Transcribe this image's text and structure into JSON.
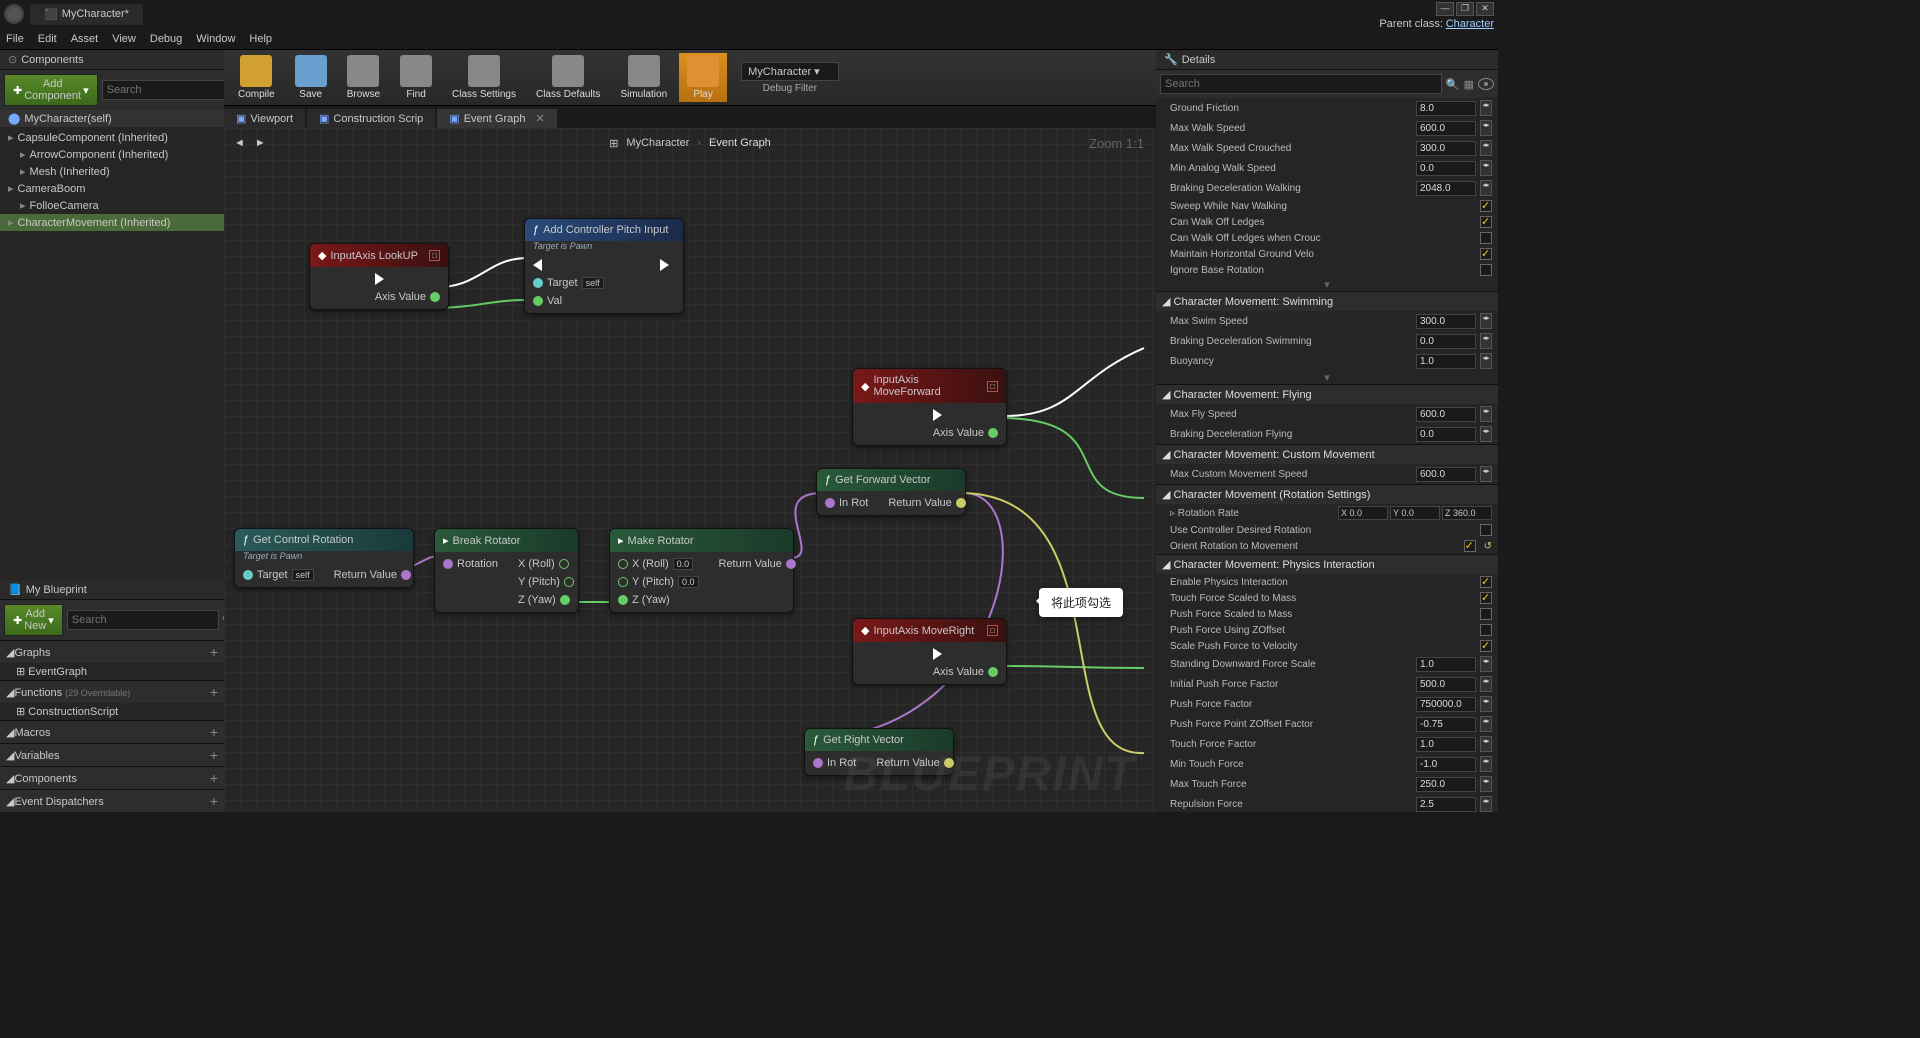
{
  "window": {
    "title": "MyCharacter*"
  },
  "parent_class": {
    "label": "Parent class:",
    "value": "Character"
  },
  "menu": [
    "File",
    "Edit",
    "Asset",
    "View",
    "Debug",
    "Window",
    "Help"
  ],
  "components_panel": {
    "title": "Components",
    "add_btn": "Add Component",
    "search": "Search",
    "root_actor": "MyCharacter(self)",
    "tree": [
      {
        "label": "CapsuleComponent (Inherited)",
        "indent": 0
      },
      {
        "label": "ArrowComponent (Inherited)",
        "indent": 1
      },
      {
        "label": "Mesh (Inherited)",
        "indent": 1
      },
      {
        "label": "CameraBoom",
        "indent": 0
      },
      {
        "label": "FolloeCamera",
        "indent": 1
      },
      {
        "label": "CharacterMovement (Inherited)",
        "indent": 0,
        "selected": true
      }
    ]
  },
  "my_blueprint": {
    "title": "My Blueprint",
    "add_btn": "Add New",
    "search": "Search",
    "sections": [
      {
        "name": "Graphs",
        "items": [
          "EventGraph"
        ]
      },
      {
        "name": "Functions",
        "suffix": "(29 Overridable)",
        "items": [
          "ConstructionScript"
        ]
      },
      {
        "name": "Macros",
        "items": []
      },
      {
        "name": "Variables",
        "items": []
      },
      {
        "name": "Components",
        "items": []
      },
      {
        "name": "Event Dispatchers",
        "items": []
      }
    ]
  },
  "toolbar": {
    "buttons": [
      {
        "label": "Compile",
        "color": "#d0a030"
      },
      {
        "label": "Save",
        "color": "#6aa0d0"
      },
      {
        "label": "Browse",
        "color": "#888"
      },
      {
        "label": "Find",
        "color": "#888"
      },
      {
        "label": "Class Settings",
        "color": "#888"
      },
      {
        "label": "Class Defaults",
        "color": "#888"
      },
      {
        "label": "Simulation",
        "color": "#888"
      },
      {
        "label": "Play",
        "color": "#e09030",
        "active": true
      }
    ],
    "debug_target": "MyCharacter",
    "debug_label": "Debug Filter"
  },
  "graph_tabs": [
    {
      "label": "Viewport"
    },
    {
      "label": "Construction Scrip"
    },
    {
      "label": "Event Graph",
      "active": true
    }
  ],
  "breadcrumb": {
    "icon": "⊞",
    "parent": "MyCharacter",
    "child": "Event Graph"
  },
  "zoom": "Zoom 1:1",
  "watermark": "BLUEPRINT",
  "nodes": {
    "lookup": {
      "title": "InputAxis LookUP",
      "axis": "Axis Value"
    },
    "pitch": {
      "title": "Add Controller Pitch Input",
      "sub": "Target is Pawn",
      "target": "Target",
      "self": "self",
      "val": "Val"
    },
    "forward": {
      "title": "InputAxis MoveForward",
      "axis": "Axis Value"
    },
    "right": {
      "title": "InputAxis MoveRight",
      "axis": "Axis Value"
    },
    "ctrl_rot": {
      "title": "Get Control Rotation",
      "sub": "Target is Pawn",
      "target": "Target",
      "self": "self",
      "ret": "Return Value"
    },
    "break": {
      "title": "Break Rotator",
      "rot": "Rotation",
      "x": "X (Roll)",
      "y": "Y (Pitch)",
      "z": "Z (Yaw)"
    },
    "make": {
      "title": "Make Rotator",
      "x": "X (Roll)",
      "y": "Y (Pitch)",
      "z": "Z (Yaw)",
      "v": "0.0",
      "ret": "Return Value"
    },
    "fwd_vec": {
      "title": "Get Forward Vector",
      "in": "In Rot",
      "ret": "Return Value"
    },
    "right_vec": {
      "title": "Get Right Vector",
      "in": "In Rot",
      "ret": "Return Value"
    }
  },
  "tooltip": "将此项勾选",
  "details": {
    "title": "Details",
    "search": "Search",
    "rows1": [
      {
        "l": "Ground Friction",
        "v": "8.0"
      },
      {
        "l": "Max Walk Speed",
        "v": "600.0"
      },
      {
        "l": "Max Walk Speed Crouched",
        "v": "300.0"
      },
      {
        "l": "Min Analog Walk Speed",
        "v": "0.0"
      },
      {
        "l": "Braking Deceleration Walking",
        "v": "2048.0"
      }
    ],
    "checks1": [
      {
        "l": "Sweep While Nav Walking",
        "on": true
      },
      {
        "l": "Can Walk Off Ledges",
        "on": true
      },
      {
        "l": "Can Walk Off Ledges when Crouc",
        "on": false
      },
      {
        "l": "Maintain Horizontal Ground Velo",
        "on": true
      },
      {
        "l": "Ignore Base Rotation",
        "on": false
      }
    ],
    "sec_swim": "Character Movement: Swimming",
    "swim": [
      {
        "l": "Max Swim Speed",
        "v": "300.0"
      },
      {
        "l": "Braking Deceleration Swimming",
        "v": "0.0"
      },
      {
        "l": "Buoyancy",
        "v": "1.0"
      }
    ],
    "sec_fly": "Character Movement: Flying",
    "fly": [
      {
        "l": "Max Fly Speed",
        "v": "600.0"
      },
      {
        "l": "Braking Deceleration Flying",
        "v": "0.0"
      }
    ],
    "sec_custom": "Character Movement: Custom Movement",
    "custom": [
      {
        "l": "Max Custom Movement Speed",
        "v": "600.0"
      }
    ],
    "sec_rot": "Character Movement (Rotation Settings)",
    "rot_label": "Rotation Rate",
    "rot_x": "X 0.0",
    "rot_y": "Y 0.0",
    "rot_z": "Z 360.0",
    "rot_checks": [
      {
        "l": "Use Controller Desired Rotation",
        "on": false
      },
      {
        "l": "Orient Rotation to Movement",
        "on": true,
        "revert": true
      }
    ],
    "sec_phys": "Character Movement: Physics Interaction",
    "phys_checks": [
      {
        "l": "Enable Physics Interaction",
        "on": true
      },
      {
        "l": "Touch Force Scaled to Mass",
        "on": true
      },
      {
        "l": "Push Force Scaled to Mass",
        "on": false
      },
      {
        "l": "Push Force Using ZOffset",
        "on": false
      },
      {
        "l": "Scale Push Force to Velocity",
        "on": true
      }
    ],
    "phys_rows": [
      {
        "l": "Standing Downward Force Scale",
        "v": "1.0"
      },
      {
        "l": "Initial Push Force Factor",
        "v": "500.0"
      },
      {
        "l": "Push Force Factor",
        "v": "750000.0"
      },
      {
        "l": "Push Force Point ZOffset Factor",
        "v": "-0.75"
      },
      {
        "l": "Touch Force Factor",
        "v": "1.0"
      },
      {
        "l": "Min Touch Force",
        "v": "-1.0"
      },
      {
        "l": "Max Touch Force",
        "v": "250.0"
      },
      {
        "l": "Repulsion Force",
        "v": "2.5"
      }
    ]
  }
}
